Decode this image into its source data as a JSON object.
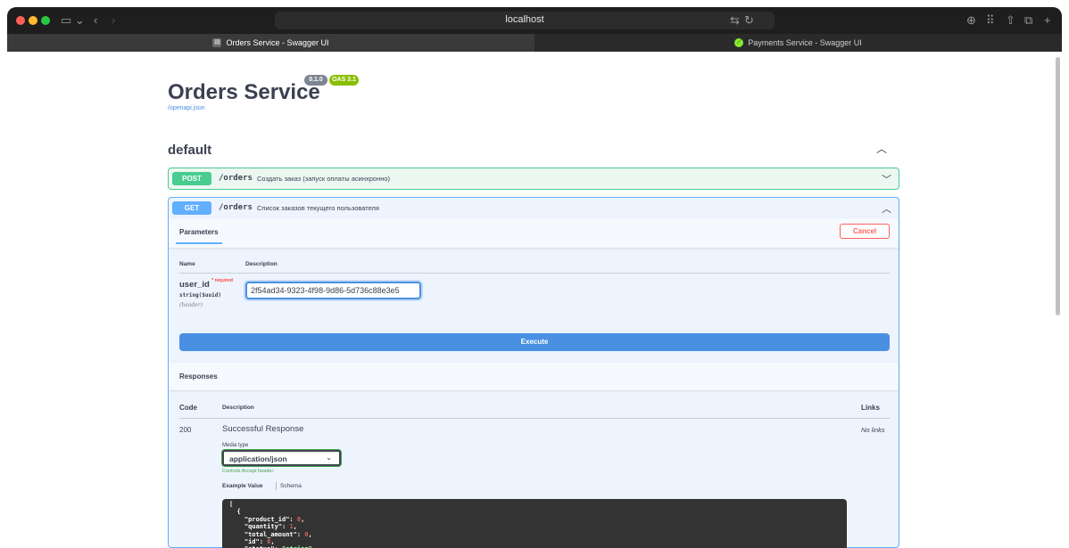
{
  "browser": {
    "url": "localhost",
    "tabs": [
      {
        "label": "Orders Service - Swagger UI",
        "active": true
      },
      {
        "label": "Payments Service - Swagger UI",
        "active": false
      }
    ],
    "traffic_colors": [
      "#ff5f57",
      "#febc2e",
      "#28c840"
    ]
  },
  "header": {
    "title": "Orders Service",
    "version_badge": "0.1.0",
    "oas_badge": "OAS 3.1",
    "spec_link": "/openapi.json"
  },
  "section": {
    "title": "default"
  },
  "operations": {
    "post": {
      "method": "POST",
      "path": "/orders",
      "summary": "Создать заказ (запуск оплаты асинхронно)",
      "color": "#49cc90"
    },
    "get": {
      "method": "GET",
      "path": "/orders",
      "summary": "Список заказов текущего пользователя",
      "color": "#61affe",
      "params_tab": "Parameters",
      "cancel_label": "Cancel",
      "param_columns": {
        "name": "Name",
        "description": "Description"
      },
      "param": {
        "name": "user_id",
        "required": "* required",
        "type": "string($uuid)",
        "in": "(header)",
        "value": "2f54ad34-9323-4f98-9d86-5d736c88e3e5"
      },
      "execute_label": "Execute",
      "responses_title": "Responses",
      "response_columns": {
        "code": "Code",
        "description": "Description",
        "links": "Links"
      },
      "response": {
        "code": "200",
        "description": "Successful Response",
        "links": "No links",
        "media_type_label": "Media type",
        "media_type": "application/json",
        "controls_accept": "Controls Accept header.",
        "example_value_tab": "Example Value",
        "schema_tab": "Schema"
      },
      "example": [
        {
          "key": "product_id",
          "value": "0",
          "kind": "num"
        },
        {
          "key": "quantity",
          "value": "1",
          "kind": "num"
        },
        {
          "key": "total_amount",
          "value": "0",
          "kind": "num"
        },
        {
          "key": "id",
          "value": "0",
          "kind": "num"
        },
        {
          "key": "status",
          "value": "\"string\"",
          "kind": "str"
        }
      ]
    }
  }
}
